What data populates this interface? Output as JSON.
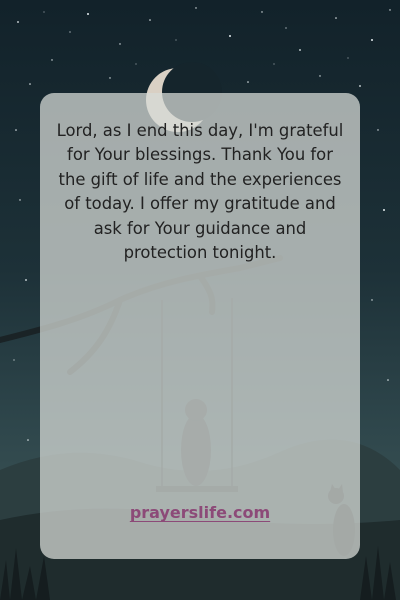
{
  "card": {
    "prayer_text": "Lord, as I end this day, I'm grateful for Your blessings. Thank You for the gift of life and the experiences of today. I offer my gratitude and ask for Your guidance and protection tonight.",
    "website": "prayerslife.com"
  },
  "colors": {
    "sky_top": "#12222a",
    "sky_bottom": "#445b5b",
    "card_background": "#d6dad6",
    "text": "#222222",
    "website_link": "#8c4a78"
  }
}
